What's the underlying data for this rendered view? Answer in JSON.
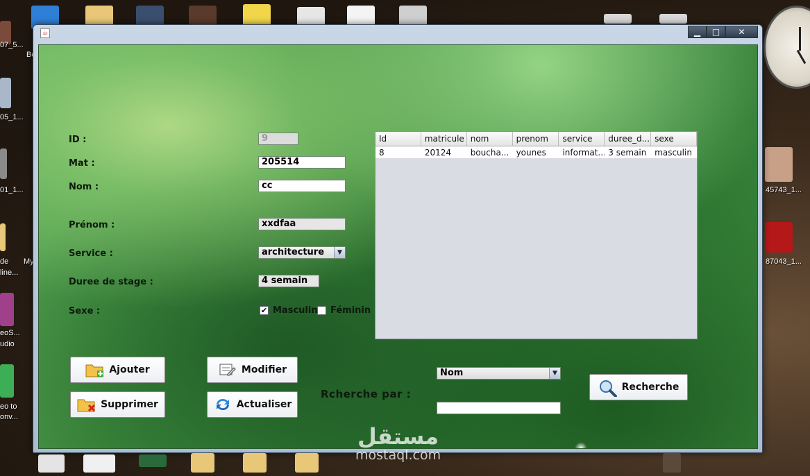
{
  "desktop": {
    "labels": [
      {
        "text": "07_5...",
        "name": "desktop-label-1"
      },
      {
        "text": "Bo",
        "name": "desktop-label-2"
      },
      {
        "text": "05_1...",
        "name": "desktop-label-3"
      },
      {
        "text": "01_1...",
        "name": "desktop-label-4"
      },
      {
        "text": "de",
        "name": "desktop-label-5"
      },
      {
        "text": "My",
        "name": "desktop-label-6"
      },
      {
        "text": "line...",
        "name": "desktop-label-7"
      },
      {
        "text": "eoS...",
        "name": "desktop-label-8"
      },
      {
        "text": "udio",
        "name": "desktop-label-9"
      },
      {
        "text": "eo to",
        "name": "desktop-label-10"
      },
      {
        "text": "onv...",
        "name": "desktop-label-11"
      },
      {
        "text": "45743_1...",
        "name": "desktop-label-12"
      },
      {
        "text": "87043_1...",
        "name": "desktop-label-13"
      }
    ]
  },
  "window": {
    "controls": {
      "minimize": "▁",
      "maximize": "□",
      "close": "✕"
    }
  },
  "form": {
    "labels": {
      "id": "ID :",
      "mat": "Mat :",
      "nom": "Nom :",
      "prenom": "Prénom :",
      "service": "Service :",
      "duree": "Duree de stage :",
      "sexe": "Sexe :"
    },
    "values": {
      "id": "9",
      "mat": "205514",
      "nom": "cc",
      "prenom": "xxdfaa",
      "service": "architecture",
      "duree": "4 semain"
    },
    "sexe": {
      "masculin_label": "Masculin",
      "masculin_checked": true,
      "feminin_label": "Féminin",
      "feminin_checked": false
    }
  },
  "table": {
    "columns": [
      "Id",
      "matricule",
      "nom",
      "prenom",
      "service",
      "duree_d...",
      "sexe"
    ],
    "rows": [
      [
        "8",
        "20124",
        "boucha...",
        "younes",
        "informat...",
        "3 semain",
        "masculin"
      ]
    ]
  },
  "buttons": {
    "ajouter": "Ajouter",
    "modifier": "Modifier",
    "supprimer": "Supprimer",
    "actualiser": "Actualiser",
    "recherche": "Recherche"
  },
  "search": {
    "label": "Rcherche par :",
    "criteria": "Nom",
    "value": ""
  },
  "watermark": {
    "arabic": "مستقل",
    "latin": "mostaql.com"
  },
  "icons": {
    "app": "java-icon",
    "ajouter": "folder-add-icon",
    "modifier": "edit-icon",
    "supprimer": "folder-delete-icon",
    "actualiser": "refresh-icon",
    "recherche": "magnifier-icon"
  },
  "colors": {
    "panel_green": "#3d8a3e",
    "table_bg": "#d9dce3",
    "button_bg": "#ffffff"
  }
}
